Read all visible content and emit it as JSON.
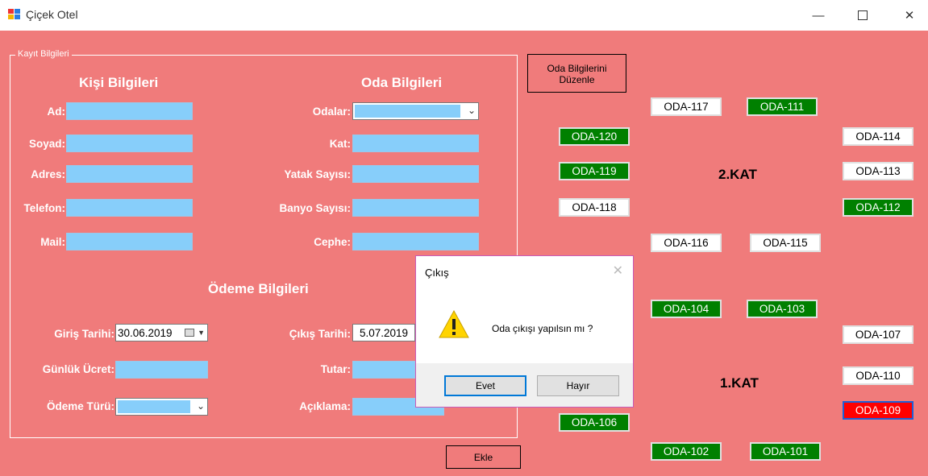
{
  "window": {
    "title": "Çiçek Otel"
  },
  "kayit_group": {
    "legend": "Kayıt Bilgileri"
  },
  "kisi": {
    "heading": "Kişi Bilgileri",
    "fields": {
      "ad": "Ad:",
      "soyad": "Soyad:",
      "adres": "Adres:",
      "telefon": "Telefon:",
      "mail": "Mail:"
    }
  },
  "oda": {
    "heading": "Oda Bilgileri",
    "fields": {
      "odalar": "Odalar:",
      "kat": "Kat:",
      "yatak": "Yatak Sayısı:",
      "banyo": "Banyo Sayısı:",
      "cephe": "Cephe:"
    }
  },
  "odeme": {
    "heading": "Ödeme Bilgileri",
    "giris_label": "Giriş Tarihi:",
    "giris_value": "30.06.2019",
    "cikis_label": "Çıkış Tarihi:",
    "cikis_value": "5.07.2019",
    "gunluk_label": "Günlük Ücret:",
    "tutar_label": "Tutar:",
    "tur_label": "Ödeme Türü:",
    "aciklama_label": "Açıklama:"
  },
  "buttons": {
    "oda_duzenle": [
      "Oda Bilgilerini",
      "Düzenle"
    ],
    "ekle": "Ekle"
  },
  "floors": {
    "kat2": "2.KAT",
    "kat1": "1.KAT"
  },
  "rooms": {
    "r117": {
      "label": "ODA-117",
      "status": "white"
    },
    "r111": {
      "label": "ODA-111",
      "status": "green"
    },
    "r120": {
      "label": "ODA-120",
      "status": "green"
    },
    "r114": {
      "label": "ODA-114",
      "status": "white"
    },
    "r119": {
      "label": "ODA-119",
      "status": "green"
    },
    "r113": {
      "label": "ODA-113",
      "status": "white"
    },
    "r118": {
      "label": "ODA-118",
      "status": "white"
    },
    "r112": {
      "label": "ODA-112",
      "status": "green"
    },
    "r116": {
      "label": "ODA-116",
      "status": "white"
    },
    "r115": {
      "label": "ODA-115",
      "status": "white"
    },
    "r104": {
      "label": "ODA-104",
      "status": "green"
    },
    "r103": {
      "label": "ODA-103",
      "status": "green"
    },
    "r107": {
      "label": "ODA-107",
      "status": "white"
    },
    "r110": {
      "label": "ODA-110",
      "status": "white"
    },
    "r109": {
      "label": "ODA-109",
      "status": "red"
    },
    "r106": {
      "label": "ODA-106",
      "status": "green"
    },
    "r102": {
      "label": "ODA-102",
      "status": "green"
    },
    "r101": {
      "label": "ODA-101",
      "status": "green"
    }
  },
  "dialog": {
    "title": "Çıkış",
    "message": "Oda çıkışı yapılsın mı ?",
    "yes": "Evet",
    "no": "Hayır"
  },
  "colors": {
    "form_bg": "#f07b7b",
    "input": "#87cefa",
    "room_green": "#008000",
    "room_red": "#ff0000",
    "dialog_border": "#c85bb9"
  },
  "icons": {
    "app": "app-icon",
    "warning": "warning-icon",
    "calendar": "calendar-icon"
  }
}
